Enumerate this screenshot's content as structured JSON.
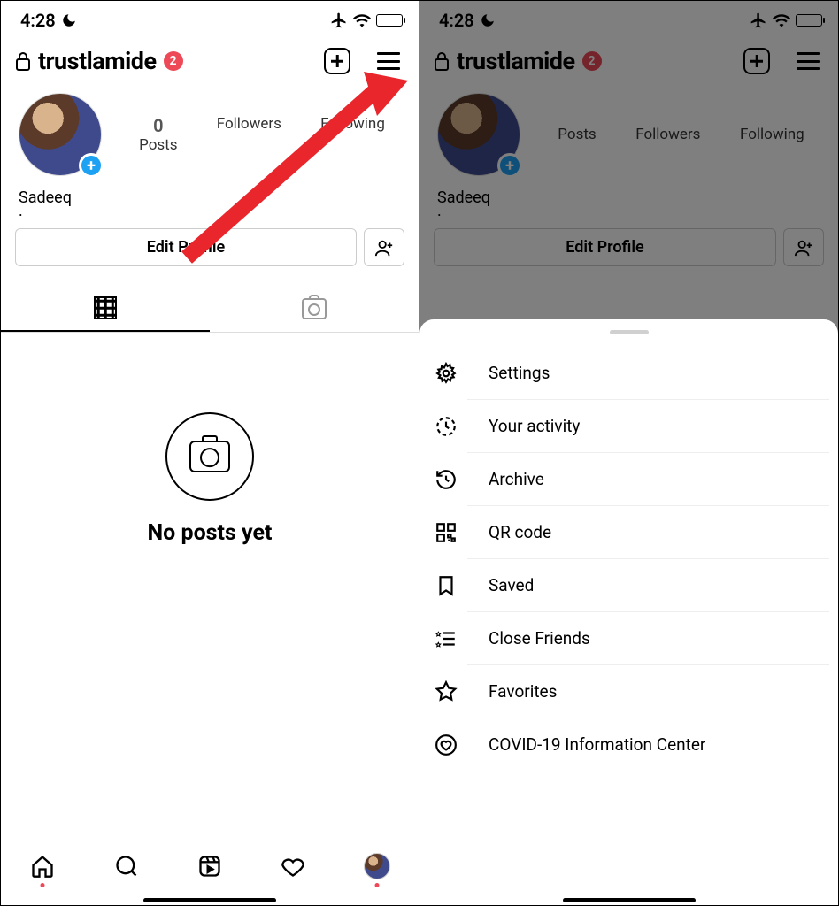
{
  "status": {
    "time": "4:28"
  },
  "profile": {
    "username": "trustlamide",
    "notifications": "2",
    "stats": {
      "posts": {
        "num": "0",
        "label": "Posts"
      },
      "followers": {
        "label": "Followers"
      },
      "following": {
        "label": "Following"
      }
    },
    "display_name": "Sadeeq",
    "bio": ".",
    "edit_label": "Edit Profile",
    "empty_state": "No posts yet"
  },
  "menu": {
    "items": [
      {
        "label": "Settings"
      },
      {
        "label": "Your activity"
      },
      {
        "label": "Archive"
      },
      {
        "label": "QR code"
      },
      {
        "label": "Saved"
      },
      {
        "label": "Close Friends"
      },
      {
        "label": "Favorites"
      },
      {
        "label": "COVID-19 Information Center"
      }
    ]
  }
}
